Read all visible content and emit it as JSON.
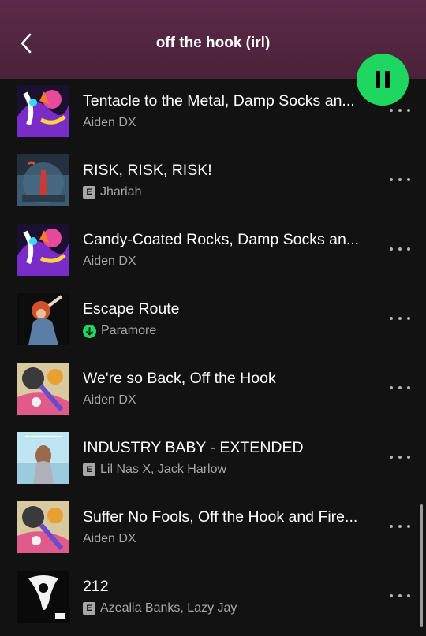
{
  "header": {
    "title": "off the hook (irl)",
    "background": "#4f253f"
  },
  "player": {
    "state": "playing",
    "accent": "#1ed760"
  },
  "tracks": [
    {
      "title": "Tentacle to the Metal, Damp Socks an...",
      "artist": "Aiden DX",
      "explicit": false,
      "downloaded": false,
      "art": "splatoon-squid"
    },
    {
      "title": "RISK, RISK, RISK!",
      "artist": "Jhariah",
      "explicit": true,
      "downloaded": false,
      "art": "risk-cover"
    },
    {
      "title": "Candy-Coated Rocks, Damp Socks an...",
      "artist": "Aiden DX",
      "explicit": false,
      "downloaded": false,
      "art": "splatoon-squid"
    },
    {
      "title": "Escape Route",
      "artist": "Paramore",
      "explicit": false,
      "downloaded": true,
      "art": "paramore-cover"
    },
    {
      "title": "We're so Back, Off the Hook",
      "artist": "Aiden DX",
      "explicit": false,
      "downloaded": false,
      "art": "off-the-hook"
    },
    {
      "title": "INDUSTRY BABY - EXTENDED",
      "artist": "Lil Nas X, Jack Harlow",
      "explicit": true,
      "downloaded": false,
      "art": "industry-baby"
    },
    {
      "title": "Suffer No Fools, Off the Hook and Fire...",
      "artist": "Aiden DX",
      "explicit": false,
      "downloaded": false,
      "art": "off-the-hook"
    },
    {
      "title": "212",
      "artist": "Azealia Banks, Lazy Jay",
      "explicit": true,
      "downloaded": false,
      "art": "212-cover"
    }
  ],
  "labels": {
    "explicit_badge": "E"
  },
  "icons": {
    "back": "chevron-left-icon",
    "pause": "pause-icon",
    "more": "more-options-icon",
    "downloaded": "downloaded-icon"
  }
}
